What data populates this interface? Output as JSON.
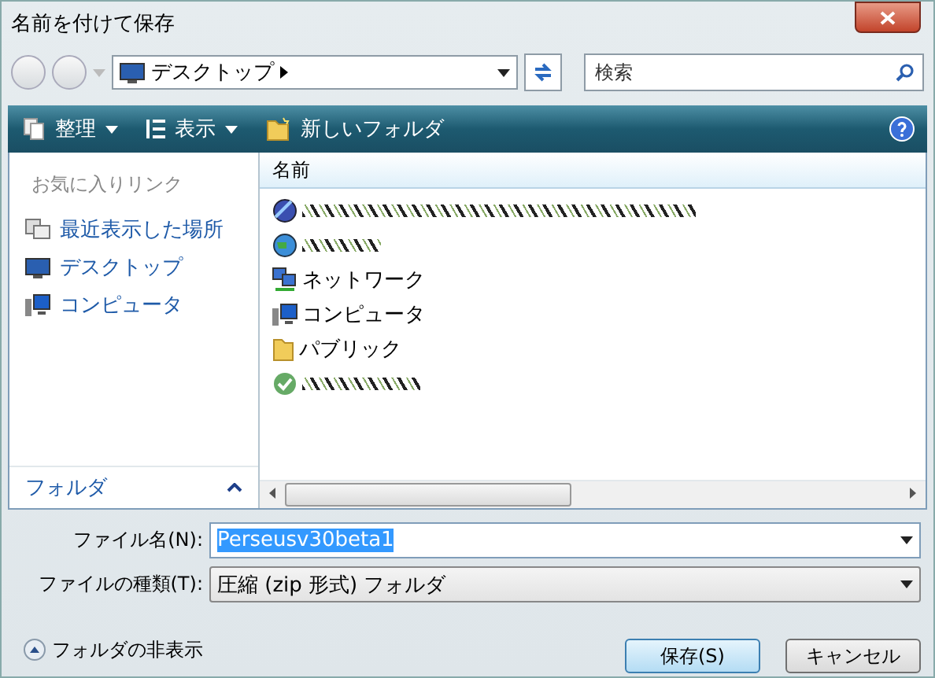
{
  "window": {
    "title": "名前を付けて保存"
  },
  "address_bar": {
    "path": "デスクトップ"
  },
  "search": {
    "placeholder": "検索"
  },
  "toolbar": [
    {
      "kind": "organize",
      "label": "整理"
    },
    {
      "kind": "views",
      "label": "表示"
    },
    {
      "kind": "new-folder",
      "label": "新しいフォルダ"
    }
  ],
  "favorites": {
    "heading": "お気に入りリンク",
    "items": [
      {
        "kind": "recent",
        "label": "最近表示した場所"
      },
      {
        "kind": "desktop",
        "label": "デスクトップ"
      },
      {
        "kind": "computer",
        "label": "コンピュータ"
      }
    ],
    "folders_label": "フォルダ"
  },
  "file_list": {
    "columns": [
      "名前"
    ],
    "items": [
      {
        "kind": "user-link"
      },
      {
        "kind": "globe"
      },
      {
        "kind": "network",
        "label": "ネットワーク"
      },
      {
        "kind": "computer",
        "label": "コンピュータ"
      },
      {
        "kind": "folder",
        "label": "パブリック"
      },
      {
        "kind": "checked-user"
      }
    ]
  },
  "file_name": {
    "label": "ファイル名(N):",
    "value": "Perseusv30beta1",
    "selected": true
  },
  "file_type": {
    "label": "ファイルの種類(T):",
    "value": "圧縮 (zip 形式) フォルダ"
  },
  "hide_folders": "フォルダの非表示",
  "buttons": [
    {
      "label": "保存(S)",
      "default": true
    },
    {
      "label": "キャンセル",
      "default": false
    }
  ]
}
